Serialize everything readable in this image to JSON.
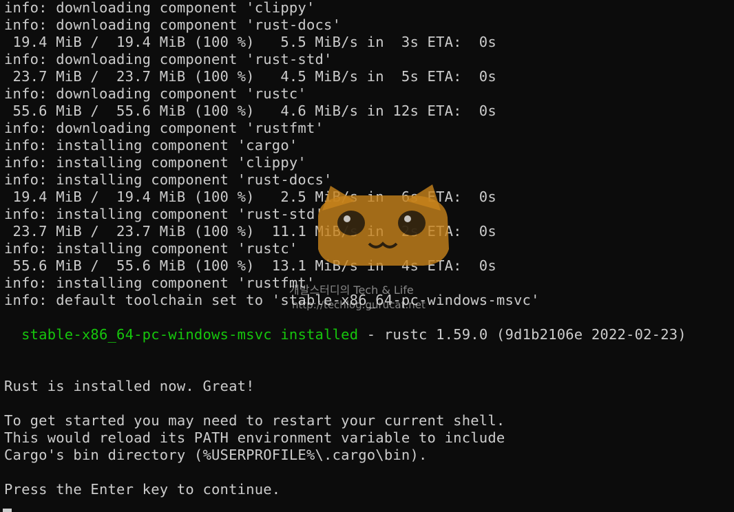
{
  "terminal": {
    "lines": [
      "info: downloading component 'clippy'",
      "info: downloading component 'rust-docs'",
      " 19.4 MiB /  19.4 MiB (100 %)   5.5 MiB/s in  3s ETA:  0s",
      "info: downloading component 'rust-std'",
      " 23.7 MiB /  23.7 MiB (100 %)   4.5 MiB/s in  5s ETA:  0s",
      "info: downloading component 'rustc'",
      " 55.6 MiB /  55.6 MiB (100 %)   4.6 MiB/s in 12s ETA:  0s",
      "info: downloading component 'rustfmt'",
      "info: installing component 'cargo'",
      "info: installing component 'clippy'",
      "info: installing component 'rust-docs'",
      " 19.4 MiB /  19.4 MiB (100 %)   2.5 MiB/s in  6s ETA:  0s",
      "info: installing component 'rust-std'",
      " 23.7 MiB /  23.7 MiB (100 %)  11.1 MiB/s in  2s ETA:  0s",
      "info: installing component 'rustc'",
      " 55.6 MiB /  55.6 MiB (100 %)  13.1 MiB/s in  4s ETA:  0s",
      "info: installing component 'rustfmt'",
      "info: default toolchain set to 'stable-x86_64-pc-windows-msvc'"
    ],
    "installed_line": {
      "indent": "  ",
      "toolchain_installed": "stable-x86_64-pc-windows-msvc installed",
      "version_info": " - rustc 1.59.0 (9d1b2106e 2022-02-23)"
    },
    "final_lines": [
      "Rust is installed now. Great!",
      "To get started you may need to restart your current shell.",
      "This would reload its PATH environment variable to include",
      "Cargo's bin directory (%USERPROFILE%\\.cargo\\bin).",
      "Press the Enter key to continue."
    ],
    "colors": {
      "background": "#0c0c0c",
      "text": "#cccccc",
      "success": "#16c60c"
    }
  },
  "watermark": {
    "blog_name": "개발스터디의 Tech & Life",
    "url": "http://techlog.gurucat.net",
    "icon": "cat-face-icon"
  }
}
